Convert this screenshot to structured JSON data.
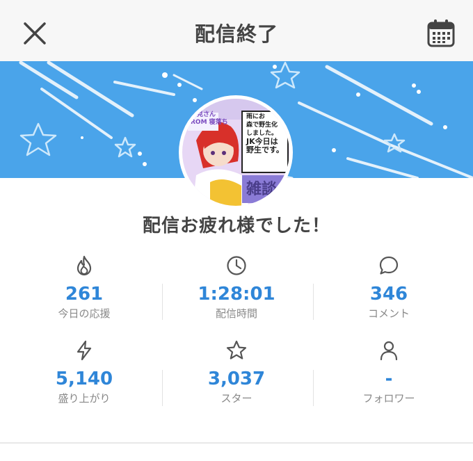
{
  "header": {
    "title": "配信終了",
    "close_icon": "close-icon",
    "calendar_icon": "calendar-icon"
  },
  "banner": {
    "background_color": "#4aa4ea",
    "thumbnail": {
      "text_lines": [
        "初見さん",
        "ROM 寝落ち",
        "雨にお",
        "森で野生化",
        "しました。",
        "JK今日は",
        "野生です。",
        "雑談"
      ]
    }
  },
  "message": "配信お疲れ様でした！",
  "stats": [
    {
      "icon": "flame-icon",
      "value": "261",
      "label": "今日の応援"
    },
    {
      "icon": "clock-icon",
      "value": "1:28:01",
      "label": "配信時間"
    },
    {
      "icon": "comment-icon",
      "value": "346",
      "label": "コメント"
    },
    {
      "icon": "lightning-icon",
      "value": "5,140",
      "label": "盛り上がり"
    },
    {
      "icon": "star-icon",
      "value": "3,037",
      "label": "スター"
    },
    {
      "icon": "person-icon",
      "value": "-",
      "label": "フォロワー"
    }
  ],
  "colors": {
    "accent": "#2f86d8",
    "header_bg": "#f7f7f7"
  }
}
